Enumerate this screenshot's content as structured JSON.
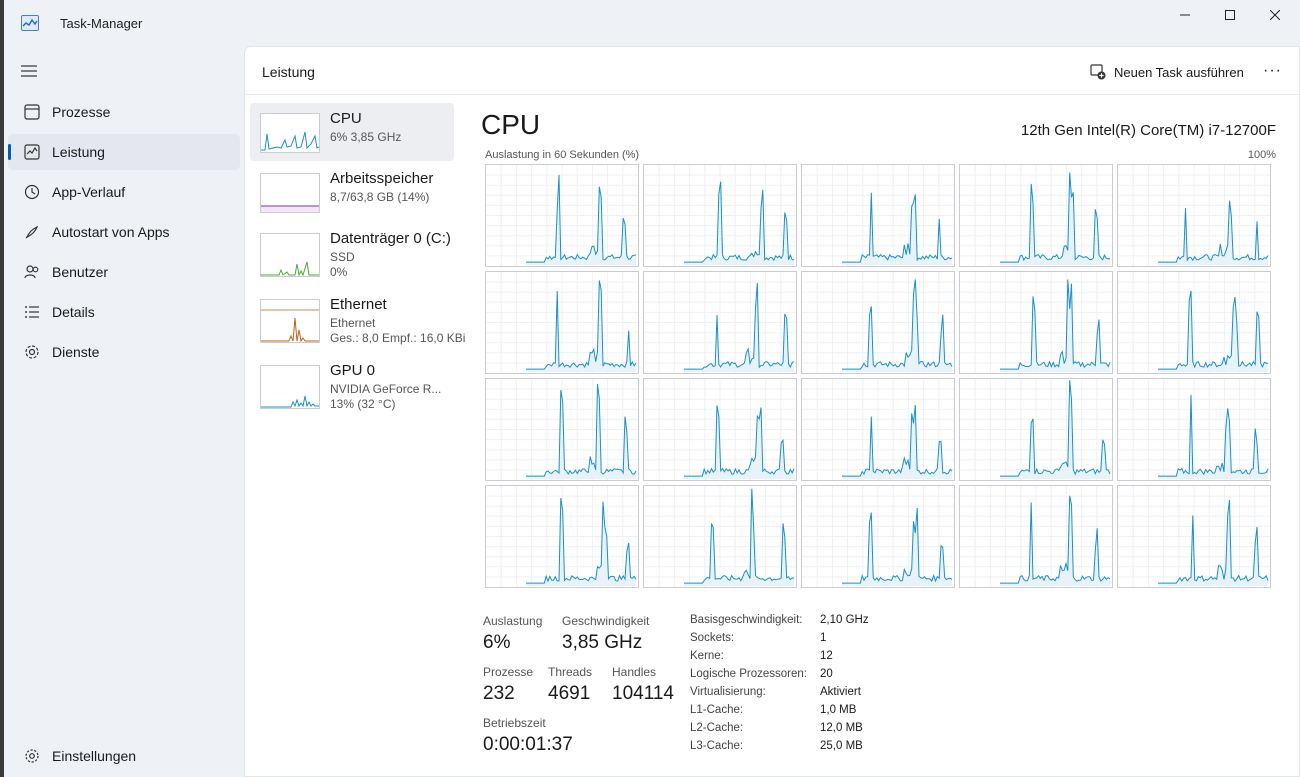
{
  "window": {
    "title": "Task-Manager",
    "minimize_glyph": "—",
    "maximize_glyph": "☐",
    "close_glyph": "✕"
  },
  "nav": {
    "items": [
      {
        "label": "Prozesse",
        "icon": "processes-icon"
      },
      {
        "label": "Leistung",
        "icon": "performance-icon",
        "active": true
      },
      {
        "label": "App-Verlauf",
        "icon": "history-icon"
      },
      {
        "label": "Autostart von Apps",
        "icon": "startup-icon"
      },
      {
        "label": "Benutzer",
        "icon": "users-icon"
      },
      {
        "label": "Details",
        "icon": "details-icon"
      },
      {
        "label": "Dienste",
        "icon": "services-icon"
      }
    ],
    "settings_label": "Einstellungen"
  },
  "header": {
    "title": "Leistung",
    "new_task_label": "Neuen Task ausführen",
    "more_label": "···"
  },
  "perf_list": [
    {
      "name": "CPU",
      "sub1": "6% 3,85 GHz",
      "sub2": "",
      "sub3": ""
    },
    {
      "name": "Arbeitsspeicher",
      "sub1": "8,7/63,8 GB (14%)",
      "sub2": "",
      "sub3": ""
    },
    {
      "name": "Datenträger 0 (C:)",
      "sub1": "SSD",
      "sub2": "0%",
      "sub3": ""
    },
    {
      "name": "Ethernet",
      "sub1": "Ethernet",
      "sub2": "Ges.: 8,0 Empf.: 16,0 KBi",
      "sub3": ""
    },
    {
      "name": "GPU 0",
      "sub1": "NVIDIA GeForce R...",
      "sub2": "13% (32 °C)",
      "sub3": ""
    }
  ],
  "cpu": {
    "title": "CPU",
    "model": "12th Gen Intel(R) Core(TM) i7-12700F",
    "graph_label": "Auslastung in 60 Sekunden (%)",
    "graph_max": "100%",
    "core_count": 20
  },
  "stats": {
    "auslastung_label": "Auslastung",
    "auslastung": "6%",
    "geschwindigkeit_label": "Geschwindigkeit",
    "geschwindigkeit": "3,85 GHz",
    "prozesse_label": "Prozesse",
    "prozesse": "232",
    "threads_label": "Threads",
    "threads": "4691",
    "handles_label": "Handles",
    "handles": "104114",
    "betriebszeit_label": "Betriebszeit",
    "betriebszeit": "0:00:01:37"
  },
  "info": [
    {
      "k": "Basisgeschwindigkeit:",
      "v": "2,10 GHz"
    },
    {
      "k": "Sockets:",
      "v": "1"
    },
    {
      "k": "Kerne:",
      "v": "12"
    },
    {
      "k": "Logische Prozessoren:",
      "v": "20"
    },
    {
      "k": "Virtualisierung:",
      "v": "Aktiviert"
    },
    {
      "k": "L1-Cache:",
      "v": "1,0 MB"
    },
    {
      "k": "L2-Cache:",
      "v": "12,0 MB"
    },
    {
      "k": "L3-Cache:",
      "v": "25,0 MB"
    }
  ],
  "colors": {
    "accent": "#005fb8",
    "cpu_line": "#1b8fc7",
    "cpu_fill": "#e8f2f9",
    "mem_line": "#8b2fa8",
    "disk_line": "#4caa3a",
    "net_line": "#c15f1a"
  }
}
